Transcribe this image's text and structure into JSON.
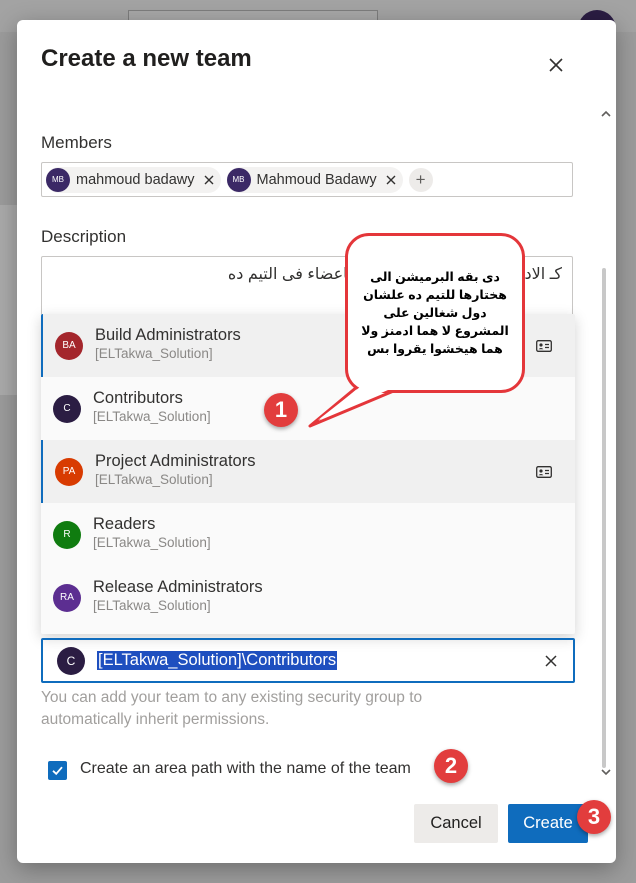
{
  "dialog": {
    "title": "Create a new team",
    "members_label": "Members",
    "description_label": "Description",
    "description_value": "كـ الادمن و محمود بدوى العادى كاعضاء فى التيم ده",
    "members": [
      {
        "initials": "MB",
        "name": "mahmoud badawy"
      },
      {
        "initials": "MB",
        "name": "Mahmoud Badawy"
      }
    ],
    "add_member_symbol": "+",
    "group_options": [
      {
        "initials": "BA",
        "name": "Build Administrators",
        "org": "[ELTakwa_Solution]",
        "color": "#a4262c",
        "selected": true
      },
      {
        "initials": "C",
        "name": "Contributors",
        "org": "[ELTakwa_Solution]",
        "color": "#2b1d43",
        "selected": false
      },
      {
        "initials": "PA",
        "name": "Project Administrators",
        "org": "[ELTakwa_Solution]",
        "color": "#d83b01",
        "selected": true
      },
      {
        "initials": "R",
        "name": "Readers",
        "org": "[ELTakwa_Solution]",
        "color": "#107c10",
        "selected": false
      },
      {
        "initials": "RA",
        "name": "Release Administrators",
        "org": "[ELTakwa_Solution]",
        "color": "#5c2e91",
        "selected": false
      }
    ],
    "group_value_initials": "C",
    "group_value": "[ELTakwa_Solution]\\Contributors",
    "group_helper": "You can add your team to any existing security group to automatically inherit permissions.",
    "area_path_label": "Create an area path with the name of the team",
    "area_path_checked": true,
    "cancel_label": "Cancel",
    "create_label": "Create"
  },
  "annotations": {
    "bubble_text": "دى بقه البرميشن الى هختارها للتيم ده علشان دول شغالين على المشروع لا هما ادمنز ولا هما هيخشوا يقروا بس",
    "badge_1": "1",
    "badge_2": "2",
    "badge_3": "3"
  },
  "colors": {
    "accent": "#0f6cbd",
    "annotation_red": "#e23d3d"
  }
}
